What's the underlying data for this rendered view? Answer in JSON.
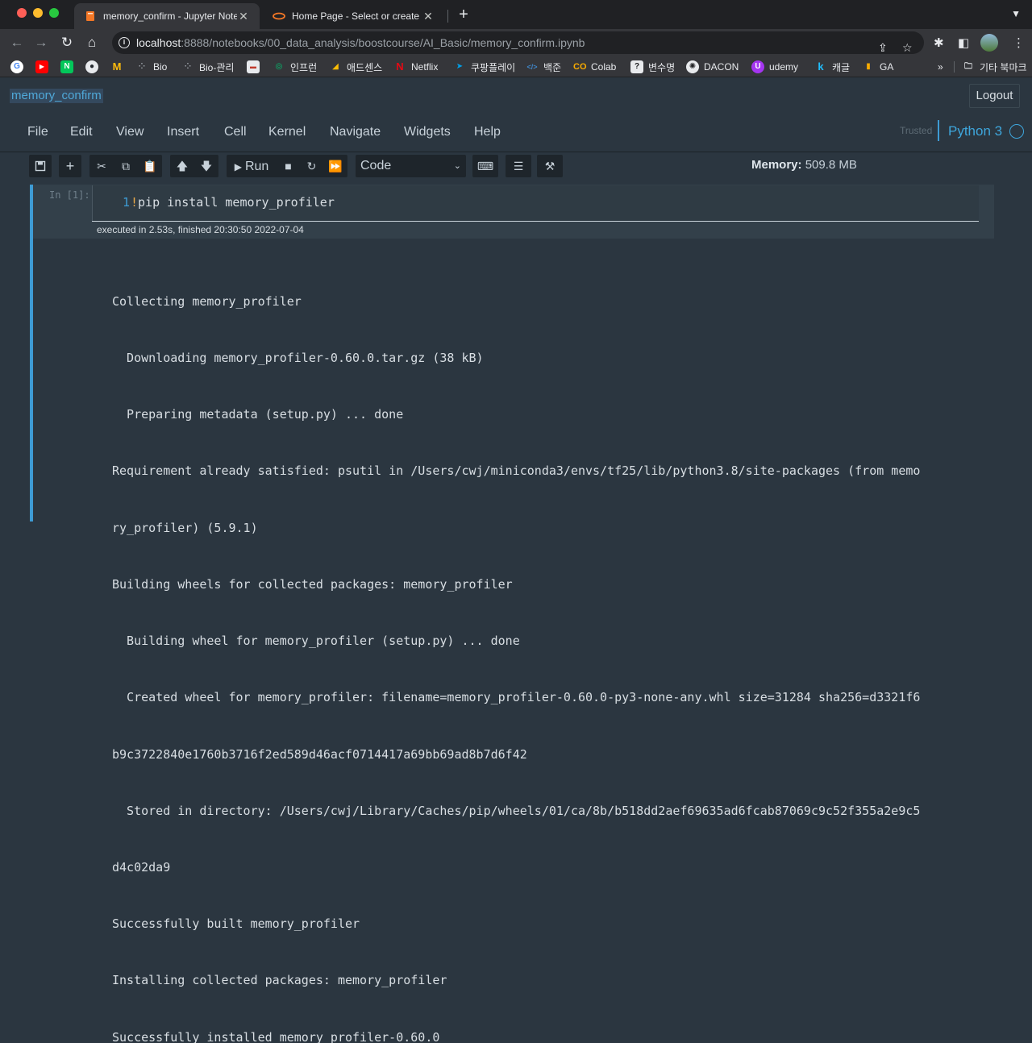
{
  "browser": {
    "tabs": [
      {
        "title": "memory_confirm - Jupyter Notebook",
        "active": true,
        "icon": "jupyter-book-icon"
      },
      {
        "title": "Home Page - Select or create a notebook",
        "active": false,
        "icon": "jupyter-ring-icon"
      }
    ],
    "url_host": "localhost",
    "url_rest": ":8888/notebooks/00_data_analysis/boostcourse/AI_Basic/memory_confirm.ipynb",
    "bookmarks": [
      {
        "label": "",
        "icon": "google-icon",
        "color": "#ffffff"
      },
      {
        "label": "",
        "icon": "youtube-icon",
        "color": "#ff0000"
      },
      {
        "label": "",
        "icon": "naver-icon",
        "color": "#03c75a"
      },
      {
        "label": "",
        "icon": "github-icon",
        "color": "#24292f"
      },
      {
        "label": "",
        "icon": "mcdonalds-icon",
        "color": "#ffbc0d"
      },
      {
        "label": "Bio",
        "icon": "dots-icon",
        "color": "#5f6368"
      },
      {
        "label": "Bio-관리",
        "icon": "dots-icon",
        "color": "#5f6368"
      },
      {
        "label": "",
        "icon": "window-icon",
        "color": "#e8eaed"
      },
      {
        "label": "인프런",
        "icon": "inflearn-icon",
        "color": "#00c471"
      },
      {
        "label": "애드센스",
        "icon": "adsense-icon",
        "color": "#fbbc04"
      },
      {
        "label": "Netflix",
        "icon": "netflix-icon",
        "color": "#e50914"
      },
      {
        "label": "쿠팡플레이",
        "icon": "coupang-icon",
        "color": "#00a0e9"
      },
      {
        "label": "백준",
        "icon": "code-icon",
        "color": "#3f84c5"
      },
      {
        "label": "Colab",
        "icon": "colab-icon",
        "color": "#f9ab00"
      },
      {
        "label": "변수명",
        "icon": "question-icon",
        "color": "#5f6368"
      },
      {
        "label": "DACON",
        "icon": "dacon-icon",
        "color": "#e8eaed"
      },
      {
        "label": "udemy",
        "icon": "udemy-icon",
        "color": "#a435f0"
      },
      {
        "label": "캐글",
        "icon": "kaggle-icon",
        "color": "#20beff"
      },
      {
        "label": "GA",
        "icon": "analytics-icon",
        "color": "#f9ab00"
      }
    ],
    "other_bookmarks": "기타 북마크",
    "more": "»"
  },
  "jupyter": {
    "notebook_title": "memory_confirm",
    "logout": "Logout",
    "menu": [
      "File",
      "Edit",
      "View",
      "Insert",
      "Cell",
      "Kernel",
      "Navigate",
      "Widgets",
      "Help"
    ],
    "trusted": "Trusted",
    "kernel": "Python 3",
    "run_label": "Run",
    "cell_type": "Code",
    "memory_label": "Memory:",
    "memory_value": "509.8 MB"
  },
  "cell": {
    "prompt": "In [1]:",
    "line_number": "1",
    "code_bang": "!",
    "code": "pip install memory_profiler",
    "exec_info": "executed in 2.53s, finished 20:30:50 2022-07-04",
    "output": [
      "Collecting memory_profiler",
      "  Downloading memory_profiler-0.60.0.tar.gz (38 kB)",
      "  Preparing metadata (setup.py) ... done",
      "Requirement already satisfied: psutil in /Users/cwj/miniconda3/envs/tf25/lib/python3.8/site-packages (from memo",
      "ry_profiler) (5.9.1)",
      "Building wheels for collected packages: memory_profiler",
      "  Building wheel for memory_profiler (setup.py) ... done",
      "  Created wheel for memory_profiler: filename=memory_profiler-0.60.0-py3-none-any.whl size=31284 sha256=d3321f6",
      "b9c3722840e1760b3716f2ed589d46acf0714417a69bb69ad8b7d6f42",
      "  Stored in directory: /Users/cwj/Library/Caches/pip/wheels/01/ca/8b/b518dd2aef69635ad6fcab87069c9c52f355a2e9c5",
      "d4c02da9",
      "Successfully built memory_profiler",
      "Installing collected packages: memory_profiler",
      "Successfully installed memory_profiler-0.60.0"
    ]
  }
}
